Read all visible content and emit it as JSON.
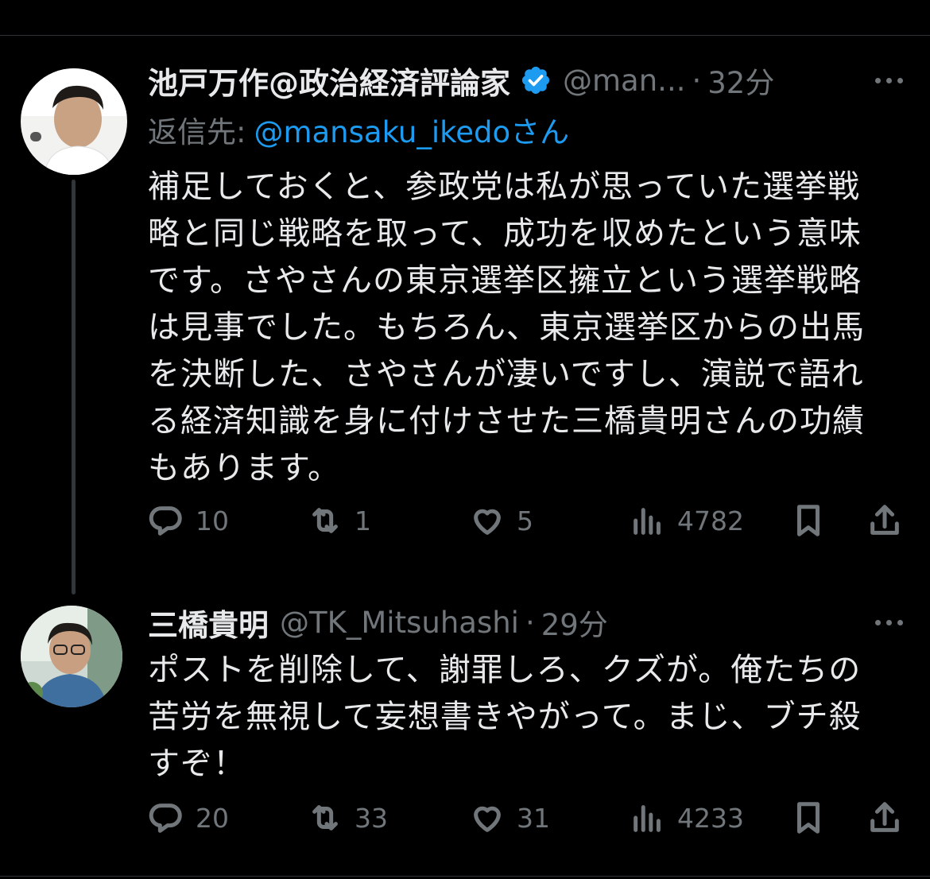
{
  "posts": [
    {
      "display_name": "池戸万作@政治経済評論家",
      "handle": "@man...",
      "separator": "·",
      "time": "32分",
      "verified": true,
      "reply_to": {
        "prefix": "返信先:",
        "mention": "@mansaku_ikedo",
        "suffix": "さん"
      },
      "body": "補足しておくと、参政党は私が思っていた選挙戦\n略と同じ戦略を取って、成功を収めたという意味\nです。さやさんの東京選挙区擁立という選挙戦略\nは見事でした。もちろん、東京選挙区からの出馬\nを決断した、さやさんが凄いですし、演説で語れ\nる経済知識を身に付けさせた三橋貴明さんの功績\nもあります。",
      "stats": {
        "replies": "10",
        "reposts": "1",
        "likes": "5",
        "views": "4782"
      }
    },
    {
      "display_name": "三橋貴明",
      "handle": "@TK_Mitsuhashi",
      "separator": "·",
      "time": "29分",
      "verified": false,
      "body": "ポストを削除して、謝罪しろ、クズが。俺たちの\n苦労を無視して妄想書きやがって。まじ、ブチ殺\nすぞ！",
      "stats": {
        "replies": "20",
        "reposts": "33",
        "likes": "31",
        "views": "4233"
      }
    }
  ],
  "icons": {
    "reply": "reply-icon",
    "repost": "repost-icon",
    "like": "heart-icon",
    "views": "analytics-icon",
    "bookmark": "bookmark-icon",
    "share": "share-icon",
    "more": "more-icon",
    "verified": "verified-badge-icon"
  },
  "colors": {
    "background": "#000000",
    "text": "#e7e9ea",
    "secondary": "#71767b",
    "accent": "#1d9bf0",
    "divider": "#2f3336"
  }
}
